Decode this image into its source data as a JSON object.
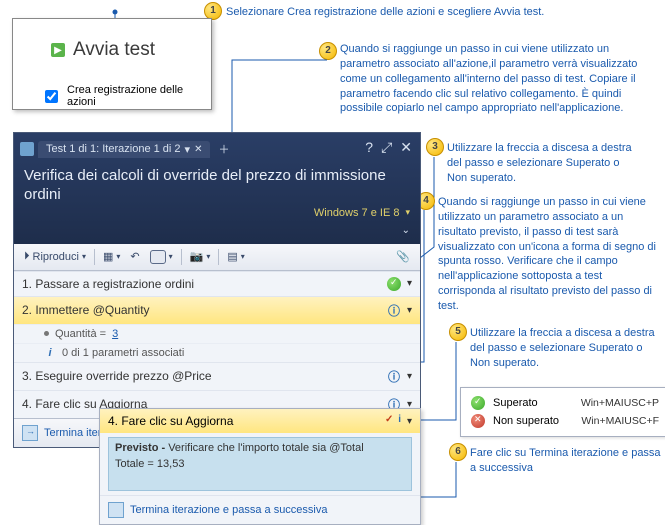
{
  "popout": {
    "start_label": "Avvia test",
    "checkbox_label": "Crea registrazione delle azioni"
  },
  "callouts": {
    "c1": "Selezionare Crea registrazione delle azioni e scegliere Avvia test.",
    "c2": "Quando si raggiunge un passo in cui viene utilizzato un parametro associato all'azione,il parametro verrà visualizzato come un collegamento all'interno del passo di test. Copiare il parametro facendo clic sul relativo collegamento. È quindi possibile copiarlo nel campo appropriato nell'applicazione.",
    "c3": "Utilizzare la freccia a discesa a destra del passo e selezionare Superato o Non superato.",
    "c4": "Quando si raggiunge un passo in cui viene utilizzato un parametro associato a un risultato previsto, il passo di test sarà visualizzato con un'icona a forma di segno di spunta rosso. Verificare che il campo nell'applicazione sottoposta a test corrisponda al risultato previsto del passo di test.",
    "c5": "Utilizzare la freccia a discesa a destra del passo e selezionare Superato o Non superato.",
    "c6": "Fare clic su Termina iterazione e passa a successiva"
  },
  "runner": {
    "tab_label": "Test 1 di 1: Iterazione 1 di 2",
    "title": "Verifica dei calcoli di override del prezzo di immissione ordini",
    "config": "Windows 7 e IE 8",
    "toolbar": {
      "play": "Riproduci"
    },
    "steps": {
      "s1": "1. Passare a registrazione ordini",
      "s2": "2. Immettere @Quantity",
      "s2a_label": "Quantità =",
      "s2a_value": "3",
      "s2b": "0 di 1 parametri associati",
      "s3": "3. Eseguire override prezzo @Price",
      "s4": "4. Fare clic su Aggiorna"
    },
    "footer": "Termina iterazione e passa a successiva"
  },
  "detail": {
    "step": "4. Fare clic su Aggiorna",
    "expected_label": "Previsto -",
    "expected_text": "Verificare che l'importo totale sia @Total",
    "total_label": "Totale =",
    "total_value": "13,53",
    "footer": "Termina iterazione e passa a successiva"
  },
  "legend": {
    "pass_label": "Superato",
    "pass_shortcut": "Win+MAIUSC+P",
    "fail_label": "Non superato",
    "fail_shortcut": "Win+MAIUSC+F"
  }
}
